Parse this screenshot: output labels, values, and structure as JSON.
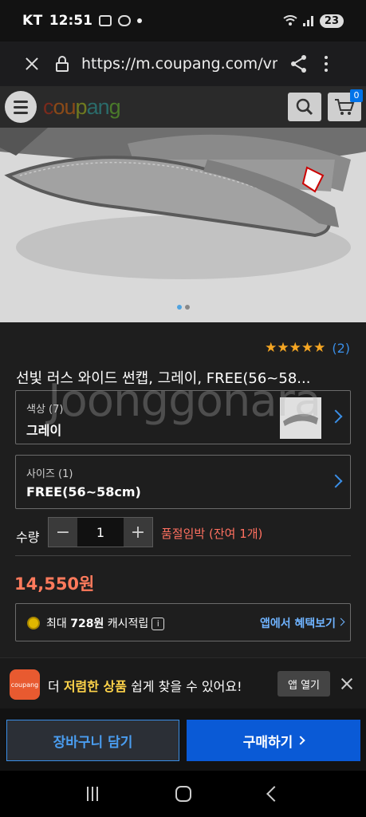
{
  "status": {
    "carrier": "KT",
    "time": "12:51",
    "battery": "23"
  },
  "browser": {
    "url": "https://m.coupang.com/vm/p"
  },
  "header": {
    "logo_parts": [
      "c",
      "ou",
      "p",
      "an",
      "g"
    ],
    "cart_count": "0"
  },
  "product": {
    "rating_stars": "★★★★★",
    "review_count": "(2)",
    "title": "선빛 러스 와이드 썬캡, 그레이, FREE(56~58...",
    "options": {
      "color_label": "색상 (7)",
      "color_value": "그레이",
      "size_label": "사이즈 (1)",
      "size_value": "FREE(56~58cm)"
    },
    "quantity_label": "수량",
    "quantity": "1",
    "stock_note": "품절임박 (잔여 1개)",
    "price": "14,550원",
    "cash": {
      "prefix": "최대 ",
      "amount": "728원",
      "suffix": " 캐시적립",
      "info": "i",
      "link": "앱에서 혜택보기"
    }
  },
  "watermark": "Joonggonara",
  "app_banner": {
    "logo_text": "coupang",
    "text_before": "더 ",
    "text_highlight": "저렴한 상품",
    "text_after": " 쉽게 찾을 수 있어요!",
    "open_button": "앱 열기"
  },
  "actions": {
    "cart_button": "장바구니 담기",
    "buy_button": "구매하기"
  },
  "colors": {
    "accent_blue": "#0a5ad6",
    "price_orange": "#ff7a5c",
    "star": "#f5a623"
  }
}
